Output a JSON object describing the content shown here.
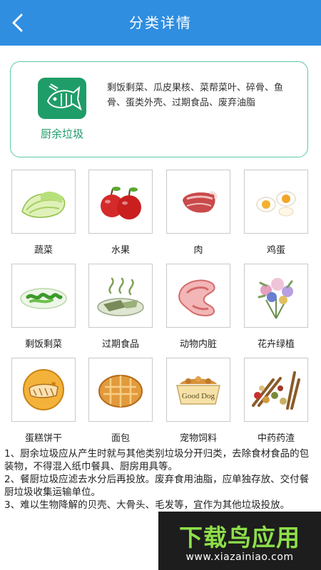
{
  "header": {
    "title": "分类详情",
    "back_icon": "chevron-left-icon"
  },
  "category": {
    "name": "厨余垃圾",
    "icon": "food-waste-fish-icon",
    "color": "#1c9a6a",
    "description": "剩饭剩菜、瓜皮果核、菜帮菜叶、碎骨、鱼骨、蛋类外壳、过期食品、废弃油脂"
  },
  "items": [
    {
      "label": "蔬菜",
      "icon": "cabbage-icon"
    },
    {
      "label": "水果",
      "icon": "apples-icon"
    },
    {
      "label": "肉",
      "icon": "meat-icon"
    },
    {
      "label": "鸡蛋",
      "icon": "eggs-icon"
    },
    {
      "label": "剩饭剩菜",
      "icon": "leftover-dish-icon"
    },
    {
      "label": "过期食品",
      "icon": "expired-food-icon"
    },
    {
      "label": "动物内脏",
      "icon": "offal-icon"
    },
    {
      "label": "花卉绿植",
      "icon": "flowers-icon"
    },
    {
      "label": "蛋糕饼干",
      "icon": "cake-biscuit-icon"
    },
    {
      "label": "面包",
      "icon": "bread-icon"
    },
    {
      "label": "宠物饲料",
      "icon": "pet-food-icon",
      "text": "Good Dog"
    },
    {
      "label": "中药药渣",
      "icon": "herbal-residue-icon"
    }
  ],
  "notes": [
    "1、厨余垃圾应从产生时就与其他类别垃圾分开归类，去除食材食品的包装物，不得混入纸巾餐具、厨房用具等。",
    "2、餐厨垃圾应滤去水分后再投放。废弃食用油脂，应单独存放、交付餐厨垃圾收集运输单位。",
    "3、难以生物降解的贝壳、大骨头、毛发等，宜作为其他垃圾投放。"
  ],
  "watermark": {
    "title": "下载鸟应用",
    "url": "www.xiazainiao.com"
  }
}
